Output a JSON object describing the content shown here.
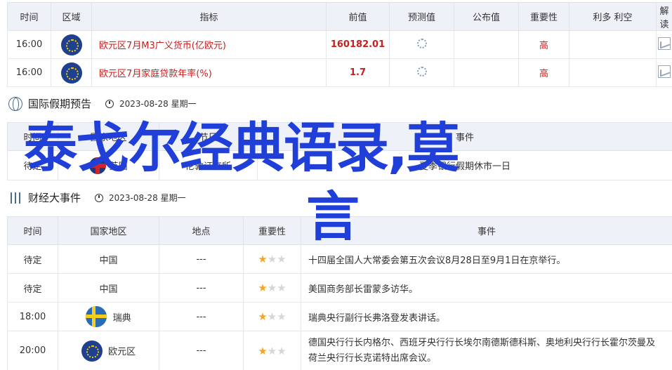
{
  "calendar": {
    "headers": [
      "时间",
      "区域",
      "指标",
      "前值",
      "预测值",
      "公布值",
      "重要性",
      "利多 利空",
      "解读"
    ],
    "rows": [
      {
        "time": "16:00",
        "region_flag": "eu-flag-icon",
        "indicator": "欧元区7月M3广义货币(亿欧元)",
        "prev": "160182.01",
        "importance": "高"
      },
      {
        "time": "16:00",
        "region_flag": "eu-flag-icon",
        "indicator": "欧元区7月家庭贷款年率(%)",
        "prev": "1.7",
        "importance": "高"
      }
    ]
  },
  "holiday": {
    "title": "国际假期预告",
    "date": "2023-08-28 星期一",
    "headers": [
      "时间",
      "国家地区",
      "节日",
      "事件"
    ],
    "row": {
      "time": "待定",
      "country": "英国",
      "holiday": "伦敦证交所",
      "event": "夏季银行假期休市一日"
    }
  },
  "events": {
    "title": "财经大事件",
    "date": "2023-08-28 星期一",
    "headers": [
      "时间",
      "国家地区",
      "地点",
      "重要性",
      "事件"
    ],
    "rows": [
      {
        "time": "待定",
        "country": "中国",
        "place": "---",
        "stars": 1,
        "event": "十四届全国人大常委会第五次会议8月28日至9月1日在京举行。"
      },
      {
        "time": "待定",
        "country": "中国",
        "place": "---",
        "stars": 1,
        "event": "美国商务部长雷蒙多访华。"
      },
      {
        "time": "18:00",
        "country": "瑞典",
        "place": "---",
        "stars": 1,
        "event": "瑞典央行副行长弗洛登发表讲话。"
      },
      {
        "time": "20:00",
        "country": "欧元区",
        "place": "---",
        "stars": 1,
        "event": "德国央行行长内格尔、西班牙央行行长埃尔南德斯德科斯、奥地利央行行长霍尔茨曼及荷兰央行行长克诺特出席会议。"
      }
    ]
  },
  "overlay": {
    "line1": "泰戈尔经典语录,莫",
    "line2": "言"
  }
}
